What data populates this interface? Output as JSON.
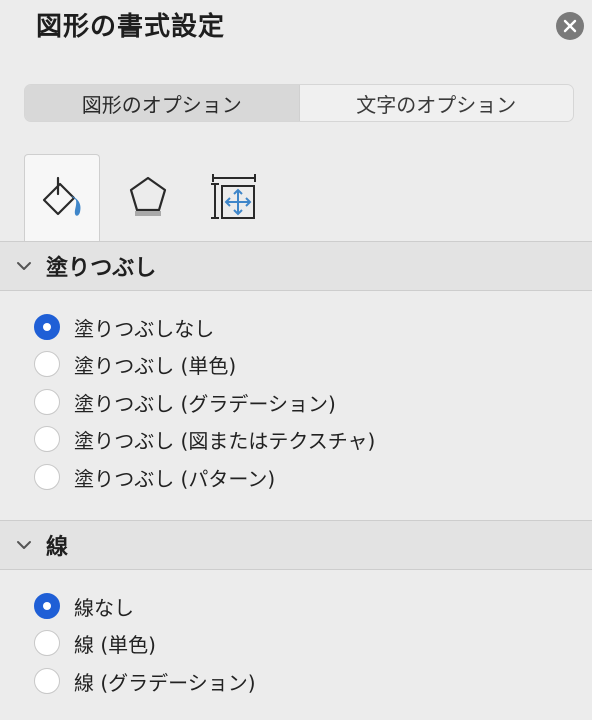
{
  "panel": {
    "title": "図形の書式設定"
  },
  "option_tabs": {
    "shape_options": "図形のオプション",
    "text_options": "文字のオプション",
    "selected": "shape_options"
  },
  "icon_tabs": [
    {
      "icon": "fill-bucket-icon",
      "selected": true
    },
    {
      "icon": "pentagon-icon",
      "selected": false
    },
    {
      "icon": "size-properties-icon",
      "selected": false
    }
  ],
  "fill_section": {
    "title": "塗りつぶし",
    "expanded": true,
    "options": [
      {
        "label": "塗りつぶしなし",
        "selected": true
      },
      {
        "label": "塗りつぶし (単色)",
        "selected": false
      },
      {
        "label": "塗りつぶし (グラデーション)",
        "selected": false
      },
      {
        "label": "塗りつぶし (図またはテクスチャ)",
        "selected": false
      },
      {
        "label": "塗りつぶし (パターン)",
        "selected": false
      }
    ]
  },
  "line_section": {
    "title": "線",
    "expanded": true,
    "options": [
      {
        "label": "線なし",
        "selected": true
      },
      {
        "label": "線 (単色)",
        "selected": false
      },
      {
        "label": "線 (グラデーション)",
        "selected": false
      }
    ]
  },
  "colors": {
    "accent": "#1f5fd6",
    "icon_blue": "#3f86c9",
    "background": "#ececec",
    "section_header": "#e3e3e3"
  }
}
